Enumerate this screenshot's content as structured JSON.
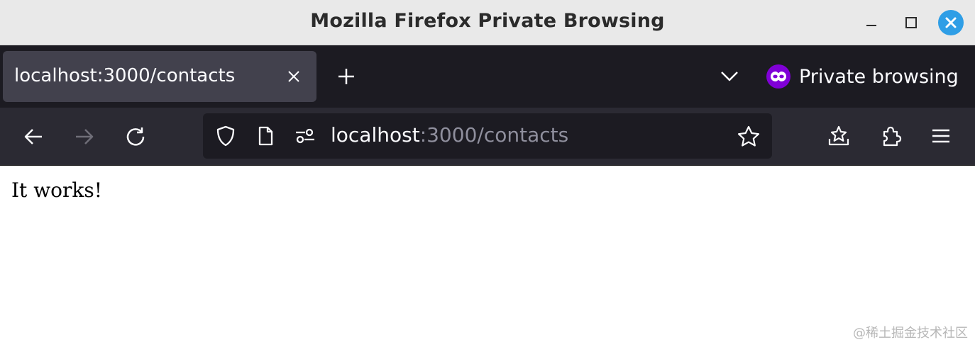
{
  "window": {
    "title": "Mozilla Firefox Private Browsing"
  },
  "tabs": [
    {
      "title": "localhost:3000/contacts",
      "active": true
    }
  ],
  "private_indicator": {
    "label": "Private browsing"
  },
  "urlbar": {
    "host": "localhost",
    "rest": ":3000/contacts"
  },
  "page": {
    "body_text": "It works!"
  },
  "watermark": {
    "text": "@稀土掘金技术社区"
  },
  "colors": {
    "titlebar_bg": "#e9e9e9",
    "tabbar_bg": "#1c1b22",
    "active_tab_bg": "#42414d",
    "navbar_bg": "#2b2a33",
    "urlbar_bg": "#1c1b22",
    "close_button": "#2f9ee6",
    "private_accent": "#8000d7"
  },
  "icons": {
    "back": "arrow-left-icon",
    "forward": "arrow-right-icon",
    "reload": "reload-icon",
    "shield": "shield-icon",
    "page": "page-icon",
    "permissions": "permissions-icon",
    "bookmark": "star-icon",
    "pocket": "pocket-star-icon",
    "extensions": "puzzle-icon",
    "menu": "hamburger-menu-icon"
  }
}
